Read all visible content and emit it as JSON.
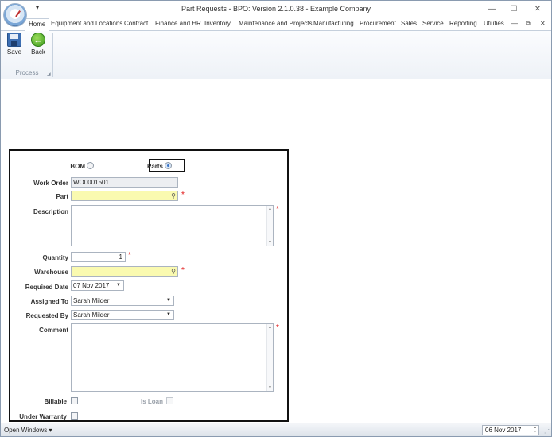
{
  "window": {
    "title": "Part Requests - BPO: Version 2.1.0.38 - Example Company",
    "qat_arrow": "▾",
    "minimize": "—",
    "maximize": "☐",
    "close": "✕"
  },
  "ribbon": {
    "tabs": [
      "Home",
      "Equipment and Locations",
      "Contract",
      "Finance and HR",
      "Inventory",
      "Maintenance and Projects",
      "Manufacturing",
      "Procurement",
      "Sales",
      "Service",
      "Reporting",
      "Utilities"
    ],
    "active_tab": "Home",
    "tab_controls": {
      "minimize": "—",
      "restore": "⧉",
      "close": "✕"
    },
    "save_label": "Save",
    "back_label": "Back",
    "group_label": "Process"
  },
  "form": {
    "bom_label": "BOM",
    "parts_label": "Parts",
    "selected_type": "Parts",
    "work_order": {
      "label": "Work Order",
      "value": "WO0001501"
    },
    "part": {
      "label": "Part",
      "value": ""
    },
    "description": {
      "label": "Description",
      "value": ""
    },
    "quantity": {
      "label": "Quantity",
      "value": "1"
    },
    "warehouse": {
      "label": "Warehouse",
      "value": ""
    },
    "required_date": {
      "label": "Required Date",
      "value": "07 Nov 2017"
    },
    "assigned_to": {
      "label": "Assigned To",
      "value": "Sarah Milder"
    },
    "requested_by": {
      "label": "Requested By",
      "value": "Sarah Milder"
    },
    "comment": {
      "label": "Comment",
      "value": ""
    },
    "billable": {
      "label": "Billable",
      "checked": false
    },
    "is_loan": {
      "label": "Is Loan",
      "checked": false,
      "enabled": false
    },
    "under_warranty": {
      "label": "Under Warranty",
      "checked": false
    },
    "required_marker": "*"
  },
  "statusbar": {
    "open_windows": "Open Windows ▾",
    "date": "06 Nov 2017"
  },
  "colors": {
    "required_field_bg": "#fafab0",
    "required_marker": "#e01010",
    "readonly_field_bg": "#eceef1"
  }
}
